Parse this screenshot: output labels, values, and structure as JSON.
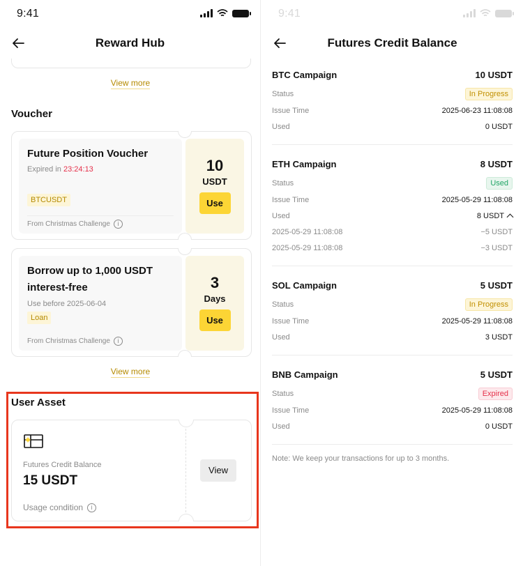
{
  "status_time": "9:41",
  "left": {
    "title": "Reward Hub",
    "view_more_top": "View more",
    "voucher_section": "Voucher",
    "vouchers": [
      {
        "title": "Future Position Voucher",
        "sub_prefix": "Expired in ",
        "sub_highlight": "23:24:13",
        "tag": "BTCUSDT",
        "from": "From Christmas Challenge",
        "amount": "10",
        "unit": "USDT",
        "button": "Use"
      },
      {
        "title_line1": "Borrow up to 1,000 USDT",
        "title_line2": "interest-free",
        "sub": "Use before 2025-06-04",
        "tag": "Loan",
        "from": "From Christmas Challenge",
        "amount": "3",
        "unit": "Days",
        "button": "Use"
      }
    ],
    "view_more_bottom": "View more",
    "asset_section": "User Asset",
    "asset": {
      "label": "Futures Credit Balance",
      "value": "15 USDT",
      "condition": "Usage condition",
      "button": "View"
    }
  },
  "right": {
    "title": "Futures Credit Balance",
    "labels": {
      "status": "Status",
      "issue_time": "Issue Time",
      "used": "Used"
    },
    "campaigns": [
      {
        "name": "BTC Campaign",
        "amount": "10 USDT",
        "status": "In Progress",
        "status_type": "progress",
        "issue_time": "2025-06-23 11:08:08",
        "used": "0 USDT"
      },
      {
        "name": "ETH Campaign",
        "amount": "8 USDT",
        "status": "Used",
        "status_type": "used",
        "issue_time": "2025-05-29 11:08:08",
        "used": "8 USDT",
        "details": [
          {
            "time": "2025-05-29 11:08:08",
            "value": "−5 USDT"
          },
          {
            "time": "2025-05-29 11:08:08",
            "value": "−3 USDT"
          }
        ]
      },
      {
        "name": "SOL Campaign",
        "amount": "5 USDT",
        "status": "In Progress",
        "status_type": "progress",
        "issue_time": "2025-05-29 11:08:08",
        "used": "3 USDT"
      },
      {
        "name": "BNB Campaign",
        "amount": "5 USDT",
        "status": "Expired",
        "status_type": "expired",
        "issue_time": "2025-05-29 11:08:08",
        "used": "0 USDT"
      }
    ],
    "note": "Note: We keep your transactions for up to 3 months."
  },
  "colors": {
    "accent_yellow": "#fcd535",
    "highlight_red": "#e8361d",
    "link_gold": "#b58a00",
    "countdown_red": "#e5304a",
    "used_green": "#20a565"
  },
  "icons": [
    "back-arrow-icon",
    "info-icon",
    "credit-card-icon",
    "chevron-up-icon",
    "signal-icon",
    "wifi-icon",
    "battery-icon"
  ]
}
